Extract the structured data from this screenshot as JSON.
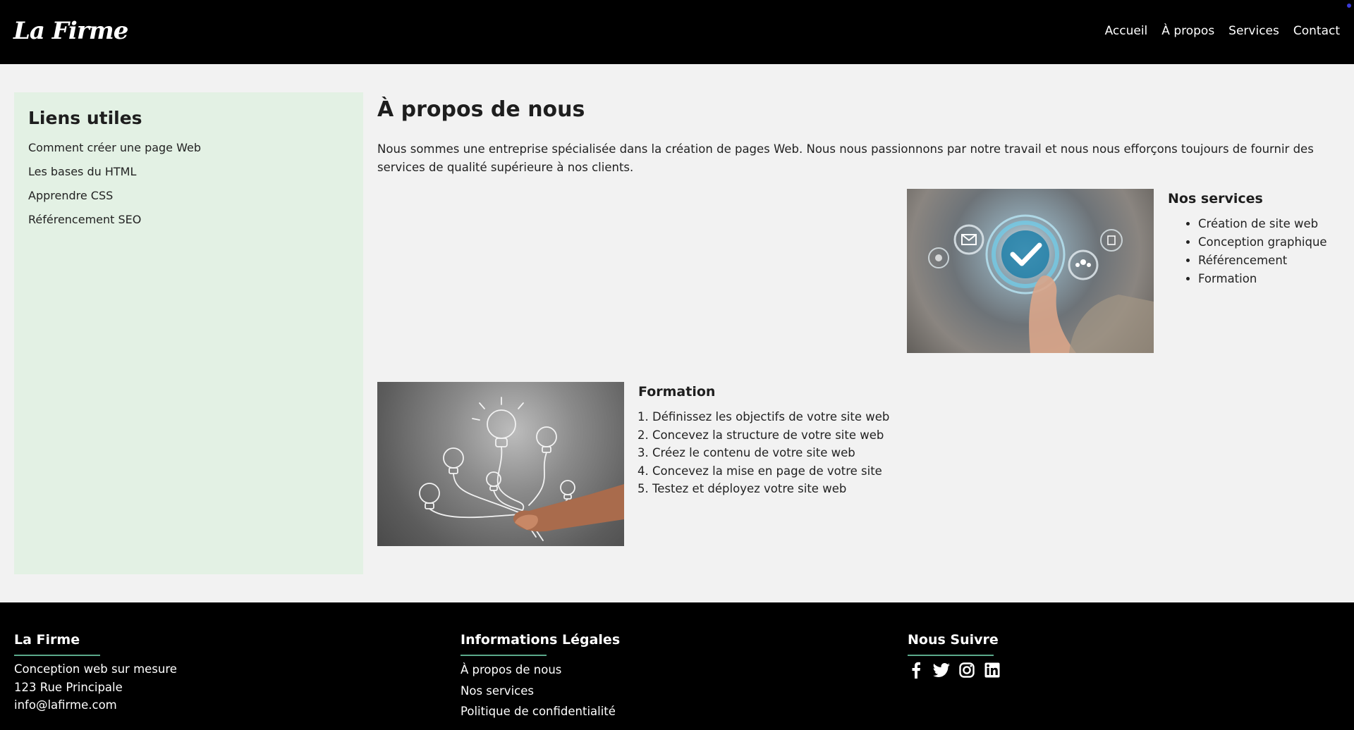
{
  "header": {
    "logo": "La Firme",
    "nav": [
      "Accueil",
      "À propos",
      "Services",
      "Contact"
    ]
  },
  "sidebar": {
    "title": "Liens utiles",
    "links": [
      "Comment créer une page Web",
      "Les bases du HTML",
      "Apprendre CSS",
      "Référencement SEO"
    ]
  },
  "main": {
    "title": "À propos de nous",
    "intro": "Nous sommes une entreprise spécialisée dans la création de pages Web. Nous nous passionnons par notre travail et nous nous efforçons toujours de fournir des services de qualité supérieure à nos clients.",
    "services": {
      "title": "Nos services",
      "items": [
        "Création de site web",
        "Conception graphique",
        "Référencement",
        "Formation"
      ]
    },
    "formation": {
      "title": "Formation",
      "items": [
        "Définissez les objectifs de votre site web",
        "Concevez la structure de votre site web",
        "Créez le contenu de votre site web",
        "Concevez la mise en page de votre site",
        "Testez et déployez votre site web"
      ]
    }
  },
  "footer": {
    "col1": {
      "title": "La Firme",
      "lines": [
        "Conception web sur mesure",
        "123 Rue Principale",
        "info@lafirme.com"
      ]
    },
    "col2": {
      "title": "Informations Légales",
      "links": [
        "À propos de nous",
        "Nos services",
        "Politique de confidentialité"
      ]
    },
    "col3": {
      "title": "Nous Suivre",
      "icons": [
        "facebook-icon",
        "twitter-icon",
        "instagram-icon",
        "linkedin-icon"
      ]
    }
  },
  "colors": {
    "header_bg": "#000000",
    "sidebar_bg": "#e3f1e4",
    "page_bg": "#f2f2f2",
    "footer_accent": "#5aa98b"
  }
}
